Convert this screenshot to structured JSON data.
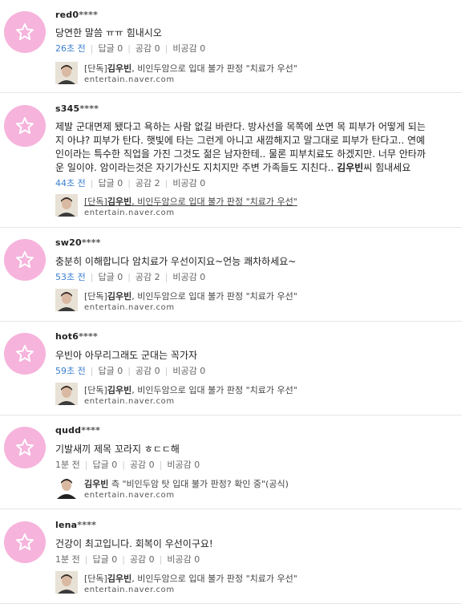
{
  "star_color": "#f6b3dc",
  "comments": [
    {
      "user": "red0",
      "stars": "****",
      "lines": [
        "당연한 말씀 ㅠㅠ 힘내시오"
      ],
      "time": "26초 전",
      "replies": "답글 0",
      "likes": "공감 0",
      "dislikes": "비공감 0",
      "article": {
        "prefix": "[단독]",
        "bold": "김우빈",
        "rest": ", 비인두암으로 입대 불가 판정 \"치료가 우선\"",
        "domain": "entertain.naver.com"
      }
    },
    {
      "user": "s345",
      "stars": "****",
      "lines": [
        "제발 군대면제 됐다고 욕하는 사람 없길 바란다. 방사선을 목쪽에 쏘면 목 피부가 어떻게 되는",
        "지 아냐? 피부가 탄다. 햇빛에 타는 그런게 아니고 새깜해지고 말그대로 피부가 탄다고.. 연예",
        "인이라는 특수한 직업을 가진 그것도 젊은 남자한테.. 물론 피부치료도 하겠지만. 너무 안타까",
        "운 일이야. 암이라는것은 자기가신도 지치지만 주변 가족들도 지친다.. ",
        "씨 힘내세요"
      ],
      "bold_in_text": "김우빈",
      "time": "44초 전",
      "replies": "답글 0",
      "likes": "공감 2",
      "dislikes": "비공감 0",
      "article": {
        "prefix": "[단독]",
        "bold": "김우빈",
        "rest": ", 비인두암으로 입대 불가 판정 \"치료가 우선\"",
        "domain": "entertain.naver.com"
      }
    },
    {
      "user": "sw20",
      "stars": "****",
      "lines": [
        "충분히 이해합니다 암치료가 우선이지요~언능 쾌차하세요~"
      ],
      "time": "53초 전",
      "replies": "답글 0",
      "likes": "공감 2",
      "dislikes": "비공감 0",
      "article": {
        "prefix": "[단독]",
        "bold": "김우빈",
        "rest": ", 비인두암으로 입대 불가 판정 \"치료가 우선\"",
        "domain": "entertain.naver.com"
      }
    },
    {
      "user": "hot6",
      "stars": "****",
      "lines": [
        "우빈아 아무리그래도 군대는 꼭가자"
      ],
      "time": "59초 전",
      "replies": "답글 0",
      "likes": "공감 0",
      "dislikes": "비공감 0",
      "article": {
        "prefix": "[단독]",
        "bold": "김우빈",
        "rest": ", 비인두암으로 입대 불가 판정 \"치료가 우선\"",
        "domain": "entertain.naver.com"
      }
    },
    {
      "user": "qudd",
      "stars": "****",
      "lines": [
        "기발새끼 제목 꼬라지 ㅎㄷㄷ해"
      ],
      "time": "1분 전",
      "replies": "답글 0",
      "likes": "공감 0",
      "dislikes": "비공감 0",
      "article": {
        "prefix": "",
        "bold": "김우빈",
        "rest": " 측 \"비인두암 탓 입대 불가 판정? 확인 중\"(공식)",
        "domain": "entertain.naver.com"
      }
    },
    {
      "user": "lena",
      "stars": "****",
      "lines": [
        "건강이 최고입니다. 회복이 우선이구요!"
      ],
      "time": "1분 전",
      "replies": "답글 0",
      "likes": "공감 0",
      "dislikes": "비공감 0",
      "article": {
        "prefix": "[단독]",
        "bold": "김우빈",
        "rest": ", 비인두암으로 입대 불가 판정 \"치료가 우선\"",
        "domain": "entertain.naver.com"
      }
    }
  ]
}
